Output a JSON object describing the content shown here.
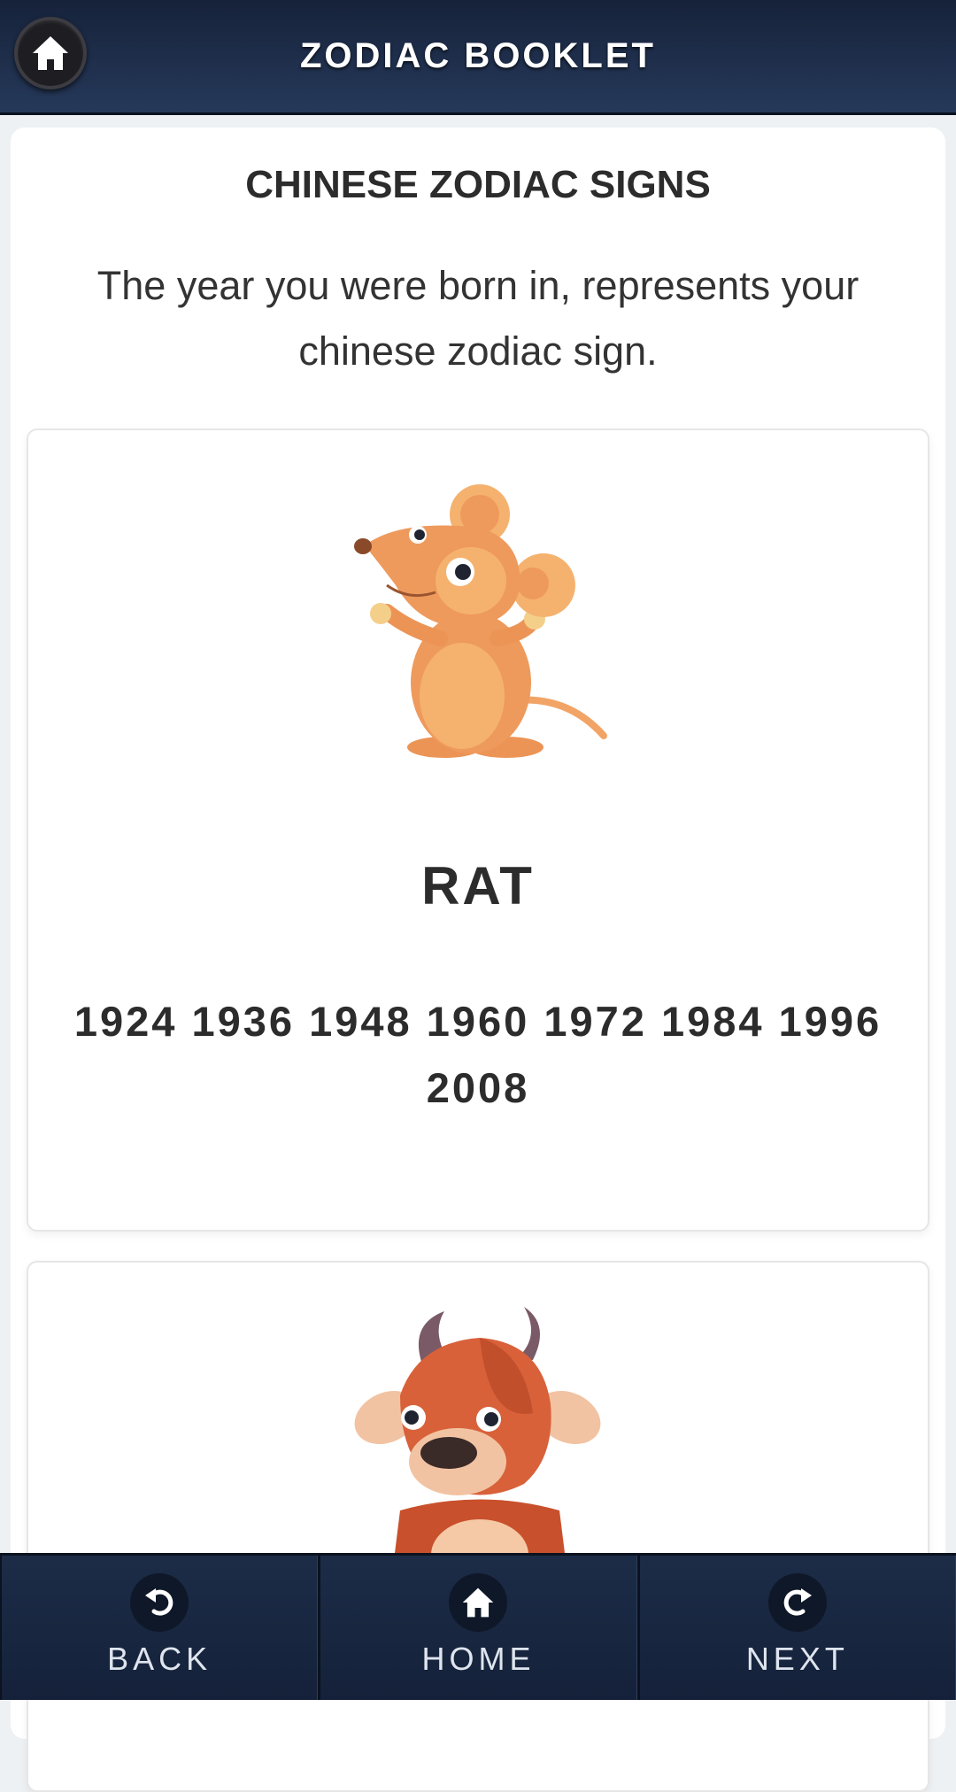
{
  "header": {
    "title": "ZODIAC BOOKLET",
    "home_icon": "home-icon"
  },
  "main": {
    "title": "CHINESE ZODIAC SIGNS",
    "intro": "The year you were born in, represents your chinese zodiac sign.",
    "signs": [
      {
        "name": "RAT",
        "years": "1924 1936 1948 1960 1972 1984 1996 2008",
        "image": "rat-illustration"
      },
      {
        "name": "",
        "years": "",
        "image": "ox-illustration"
      }
    ]
  },
  "bottom_nav": {
    "back_label": "BACK",
    "home_label": "HOME",
    "next_label": "NEXT",
    "back_icon": "undo-arrow-icon",
    "home_icon": "home-icon",
    "next_icon": "redo-arrow-icon"
  },
  "colors": {
    "header_bg": "#1f2f4c",
    "nav_bg": "#1a2842",
    "text_dark": "#2c2c2c"
  }
}
